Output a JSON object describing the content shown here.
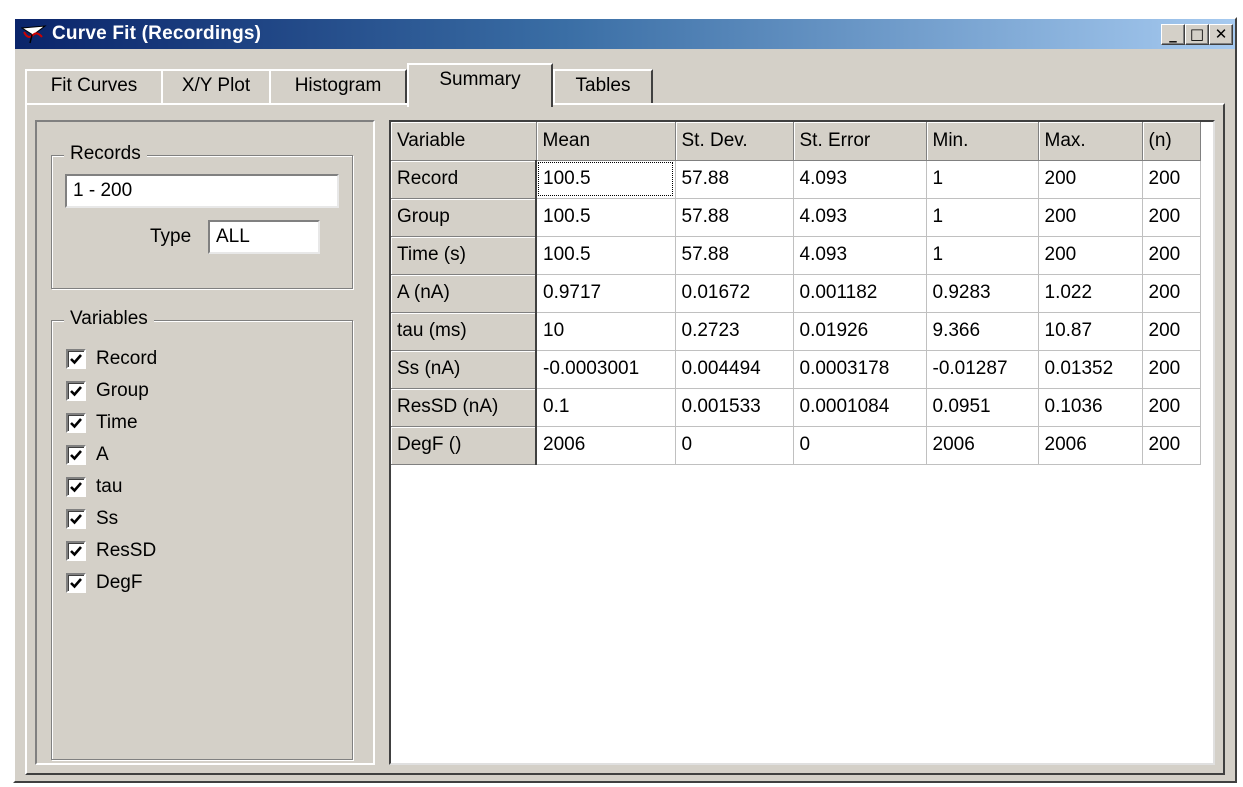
{
  "window": {
    "title": "Curve Fit (Recordings)",
    "title_icon": "waveform-app-icon",
    "controls": {
      "minimize": "_",
      "maximize": "□",
      "close": "✕"
    },
    "colors": {
      "titlebar_start": "#0a246a",
      "titlebar_end": "#a6caf0",
      "face": "#d4d0c8"
    }
  },
  "tabs": [
    {
      "label": "Fit Curves",
      "active": false
    },
    {
      "label": "X/Y Plot",
      "active": false
    },
    {
      "label": "Histogram",
      "active": false
    },
    {
      "label": "Summary",
      "active": true
    },
    {
      "label": "Tables",
      "active": false
    }
  ],
  "records_group": {
    "title": "Records",
    "range_value": "1 - 200",
    "type_label": "Type",
    "type_value": "ALL"
  },
  "variables_group": {
    "title": "Variables",
    "items": [
      {
        "label": "Record",
        "checked": true
      },
      {
        "label": "Group",
        "checked": true
      },
      {
        "label": "Time",
        "checked": true
      },
      {
        "label": "A",
        "checked": true
      },
      {
        "label": "tau",
        "checked": true
      },
      {
        "label": "Ss",
        "checked": true
      },
      {
        "label": "ResSD",
        "checked": true
      },
      {
        "label": "DegF",
        "checked": true
      }
    ]
  },
  "summary_table": {
    "columns": [
      "Variable",
      "Mean",
      "St. Dev.",
      "St. Error",
      "Min.",
      "Max.",
      "(n)"
    ],
    "rows": [
      [
        "Record",
        "100.5",
        "57.88",
        "4.093",
        "1",
        "200",
        "200"
      ],
      [
        "Group",
        "100.5",
        "57.88",
        "4.093",
        "1",
        "200",
        "200"
      ],
      [
        "Time (s)",
        "100.5",
        "57.88",
        "4.093",
        "1",
        "200",
        "200"
      ],
      [
        "A (nA)",
        "0.9717",
        "0.01672",
        "0.001182",
        "0.9283",
        "1.022",
        "200"
      ],
      [
        "tau (ms)",
        "10",
        "0.2723",
        "0.01926",
        "9.366",
        "10.87",
        "200"
      ],
      [
        "Ss (nA)",
        "-0.0003001",
        "0.004494",
        "0.0003178",
        "-0.01287",
        "0.01352",
        "200"
      ],
      [
        "ResSD (nA)",
        "0.1",
        "0.001533",
        "0.0001084",
        "0.0951",
        "0.1036",
        "200"
      ],
      [
        "DegF ()",
        "2006",
        "0",
        "0",
        "2006",
        "2006",
        "200"
      ]
    ]
  }
}
